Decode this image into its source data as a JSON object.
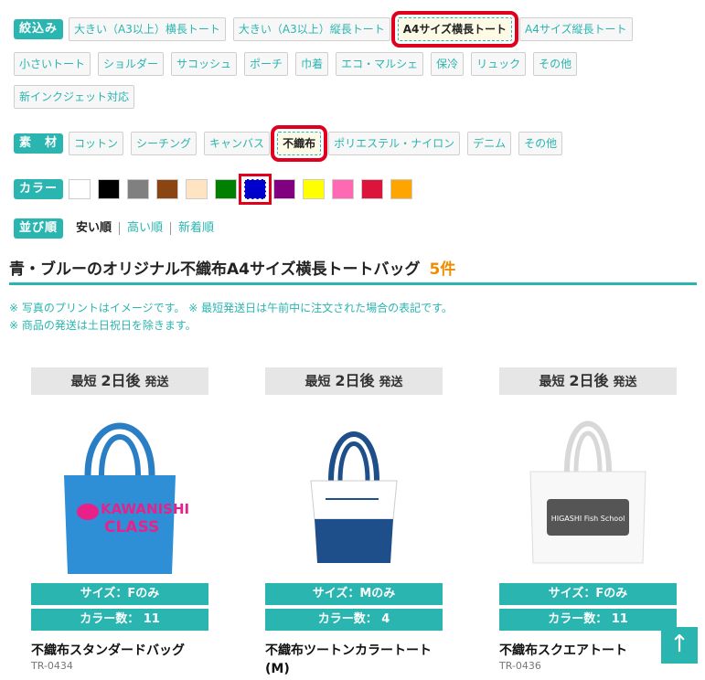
{
  "filters": {
    "narrow_label": "絞込み",
    "size_chips": [
      "大きい（A3以上）横長トート",
      "大きい（A3以上）縦長トート",
      "A4サイズ横長トート",
      "A4サイズ縦長トート",
      "小さいトート",
      "ショルダー",
      "サコッシュ",
      "ポーチ",
      "巾着",
      "エコ・マルシェ",
      "保冷",
      "リュック",
      "その他",
      "新インクジェット対応"
    ],
    "material_label": "素　材",
    "material_chips": [
      "コットン",
      "シーチング",
      "キャンバス",
      "不織布",
      "ポリエステル・ナイロン",
      "デニム",
      "その他"
    ],
    "color_label": "カラー",
    "colors": [
      "#ffffff",
      "#000000",
      "#808080",
      "#8b4513",
      "#ffe4c4",
      "#008000",
      "#0000cd",
      "#800080",
      "#ffff00",
      "#ff69b4",
      "#dc143c",
      "#ffa500"
    ],
    "sort_label": "並び順",
    "sort_options": [
      "安い順",
      "高い順",
      "新着順"
    ]
  },
  "results": {
    "title": "青・ブルーのオリジナル不織布A4サイズ横長トートバッグ",
    "count": "5件"
  },
  "notes": [
    "※ 写真のプリントはイメージです。 ※ 最短発送日は午前中に注文された場合の表記です。",
    "※ 商品の発送は土日祝日を除きます。"
  ],
  "products": [
    {
      "ship_prefix": "最短",
      "ship_days": "2日後",
      "ship_suffix": "発送",
      "size": "サイズ：Fのみ",
      "colors": "カラー数： 11",
      "name": "不織布スタンダードバッグ",
      "code": "TR-0434",
      "print_line1": "KAWANISHI",
      "print_line2": "CLASS"
    },
    {
      "ship_prefix": "最短",
      "ship_days": "2日後",
      "ship_suffix": "発送",
      "size": "サイズ：Mのみ",
      "colors": "カラー数： 4",
      "name": "不織布ツートンカラートート(M)",
      "code": "",
      "print_line1": "",
      "print_line2": ""
    },
    {
      "ship_prefix": "最短",
      "ship_days": "2日後",
      "ship_suffix": "発送",
      "size": "サイズ：Fのみ",
      "colors": "カラー数： 11",
      "name": "不織布スクエアトート",
      "code": "TR-0436",
      "print_line1": "HIGASHI Fish School",
      "print_line2": ""
    }
  ],
  "back_to_top": "↑"
}
